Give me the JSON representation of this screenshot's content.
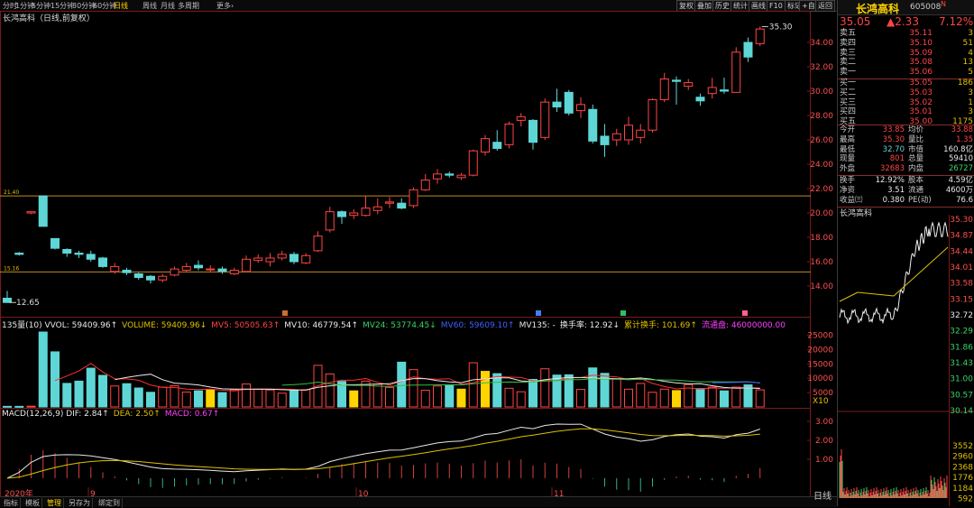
{
  "toolbar": {
    "periods": [
      "分时",
      "1分钟",
      "5分钟",
      "15分钟",
      "30分钟",
      "60分钟",
      "日线",
      "周线",
      "月线",
      "多周期",
      "更多›"
    ],
    "active_period": "日线",
    "right_buttons": [
      "复权",
      "叠加",
      "历史",
      "统计",
      "画线",
      "F10",
      "标记",
      "+自选",
      "返回"
    ]
  },
  "chart_title": "长鸿高科（日线,前复权）",
  "price_axis": [
    "34.00",
    "32.00",
    "30.00",
    "28.00",
    "26.00",
    "24.00",
    "22.00",
    "20.00",
    "18.00",
    "16.00",
    "14.00"
  ],
  "high_label": "35.30",
  "low_label": "12.65",
  "hline_labels": [
    "21.40",
    "15.16"
  ],
  "event_markers": [
    "□",
    "□",
    "□",
    "□"
  ],
  "volume": {
    "header": [
      {
        "t": "135量(10) VVOL: 59409.96↑",
        "c": "#e8e8e8"
      },
      {
        "t": "VOLUME: 59409.96↓",
        "c": "#e0c000"
      },
      {
        "t": "MV5: 50505.63↑",
        "c": "#ff4545"
      },
      {
        "t": "MV10: 46779.54↑",
        "c": "#e8e8e8"
      },
      {
        "t": "MV24: 53774.45↓",
        "c": "#3ad36b"
      },
      {
        "t": "MV60: 59609.10↑",
        "c": "#4060ff"
      },
      {
        "t": "MV135: -",
        "c": "#e8e8e8"
      },
      {
        "t": "换手率: 12.92↓",
        "c": "#e8e8e8"
      },
      {
        "t": "累计换手: 101.69↑",
        "c": "#e0c000"
      },
      {
        "t": "流通盘: 46000000.00",
        "c": "#ff40ff"
      }
    ],
    "axis": [
      "25000",
      "20000",
      "15000",
      "10000",
      "5000"
    ],
    "unit": "X10"
  },
  "macd": {
    "header": [
      {
        "t": "MACD(12,26,9) DIF: 2.84↑",
        "c": "#e8e8e8"
      },
      {
        "t": "DEA: 2.50↑",
        "c": "#e0c000"
      },
      {
        "t": "MACD: 0.67↑",
        "c": "#ff40ff"
      }
    ],
    "axis": [
      "3.00",
      "2.00",
      "1.00"
    ]
  },
  "dates": {
    "year": "2020年",
    "months": [
      "9",
      "10",
      "11"
    ]
  },
  "bottom_tabs": [
    "指标",
    "模板",
    "管理",
    "另存为",
    "绑定到"
  ],
  "active_bottom_tab": "管理",
  "period_label": "日线",
  "right": {
    "name": "长鸿高科",
    "code": "605008",
    "flag": "N",
    "price": "35.05",
    "change": "▲2.33",
    "pct": "7.12%",
    "sells": [
      {
        "l": "卖五",
        "p": "35.11",
        "v": "3"
      },
      {
        "l": "卖四",
        "p": "35.10",
        "v": "51"
      },
      {
        "l": "卖三",
        "p": "35.09",
        "v": "4"
      },
      {
        "l": "卖二",
        "p": "35.08",
        "v": "13"
      },
      {
        "l": "卖一",
        "p": "35.06",
        "v": "5"
      }
    ],
    "buys": [
      {
        "l": "买一",
        "p": "35.05",
        "v": "186"
      },
      {
        "l": "买二",
        "p": "35.03",
        "v": "3"
      },
      {
        "l": "买三",
        "p": "35.02",
        "v": "1"
      },
      {
        "l": "买四",
        "p": "35.01",
        "v": "3"
      },
      {
        "l": "买五",
        "p": "35.00",
        "v": "1175"
      }
    ],
    "stats1": [
      {
        "l": "今开",
        "v": "33.85",
        "vc": "red",
        "l2": "均价",
        "v2": "33.88",
        "v2c": "red"
      },
      {
        "l": "最高",
        "v": "35.30",
        "vc": "red",
        "l2": "量比",
        "v2": "1.35",
        "v2c": "red"
      },
      {
        "l": "最低",
        "v": "32.70",
        "vc": "cyan",
        "l2": "市值",
        "v2": "160.8亿",
        "v2c": "white"
      },
      {
        "l": "现量",
        "v": "801",
        "vc": "red",
        "l2": "总量",
        "v2": "59410",
        "v2c": "white"
      },
      {
        "l": "外盘",
        "v": "32683",
        "vc": "red",
        "l2": "内盘",
        "v2": "26727",
        "v2c": "green"
      }
    ],
    "stats2": [
      {
        "l": "换手",
        "v": "12.92%",
        "vc": "white",
        "l2": "股本",
        "v2": "4.59亿",
        "v2c": "white"
      },
      {
        "l": "净资",
        "v": "3.51",
        "vc": "white",
        "l2": "流通",
        "v2": "4600万",
        "v2c": "white"
      },
      {
        "l": "收益㈢",
        "v": "0.380",
        "vc": "white",
        "l2": "PE(动)",
        "v2": "76.6",
        "v2c": "white"
      }
    ],
    "mini_title": "长鸿高科",
    "mini_axis": [
      "35.30",
      "34.87",
      "34.44",
      "34.01",
      "33.58",
      "33.15",
      "32.72",
      "32.29",
      "31.86",
      "31.43",
      "31.00",
      "30.57",
      "30.14"
    ],
    "mini_vol_axis": [
      "3552",
      "2960",
      "2368",
      "1776",
      "1184",
      "592"
    ],
    "colors": {
      "up": "#ff4545",
      "down": "#5fd6d6",
      "accent": "#ffd400"
    }
  },
  "chart_data": {
    "type": "candlestick",
    "title": "长鸿高科（日线,前复权）",
    "ylim": [
      12,
      36
    ],
    "candles": [
      [
        13.0,
        12.65,
        13.6,
        12.65
      ],
      [
        16.7,
        16.6,
        16.8,
        16.5
      ],
      [
        20.0,
        20.1,
        20.1,
        19.9
      ],
      [
        21.4,
        18.9,
        21.4,
        18.9
      ],
      [
        17.9,
        17.1,
        17.9,
        17.0
      ],
      [
        17.0,
        16.7,
        17.1,
        16.4
      ],
      [
        16.7,
        16.6,
        16.9,
        16.3
      ],
      [
        16.6,
        16.2,
        16.9,
        16.0
      ],
      [
        16.3,
        15.6,
        16.4,
        15.5
      ],
      [
        15.2,
        15.6,
        15.9,
        15.0
      ],
      [
        15.3,
        15.1,
        15.5,
        14.9
      ],
      [
        15.0,
        14.7,
        15.1,
        14.5
      ],
      [
        14.8,
        14.5,
        14.9,
        14.2
      ],
      [
        14.5,
        14.8,
        15.0,
        14.3
      ],
      [
        14.9,
        15.4,
        15.6,
        14.8
      ],
      [
        15.3,
        15.6,
        15.9,
        15.2
      ],
      [
        15.7,
        15.5,
        16.1,
        15.3
      ],
      [
        15.4,
        15.4,
        15.7,
        15.1
      ],
      [
        15.4,
        15.2,
        15.6,
        15.0
      ],
      [
        15.0,
        15.3,
        15.5,
        14.9
      ],
      [
        15.2,
        16.2,
        16.5,
        15.2
      ],
      [
        16.1,
        16.3,
        16.6,
        15.9
      ],
      [
        16.0,
        16.3,
        16.7,
        15.6
      ],
      [
        16.3,
        16.6,
        16.9,
        16.1
      ],
      [
        16.6,
        16.0,
        16.8,
        15.8
      ],
      [
        15.9,
        16.5,
        16.7,
        15.8
      ],
      [
        16.9,
        18.1,
        18.5,
        16.8
      ],
      [
        18.6,
        20.1,
        20.5,
        18.4
      ],
      [
        20.1,
        19.7,
        20.2,
        19.1
      ],
      [
        19.8,
        20.0,
        20.3,
        19.5
      ],
      [
        19.8,
        20.4,
        21.4,
        19.7
      ],
      [
        20.2,
        20.5,
        21.2,
        19.9
      ],
      [
        20.8,
        20.9,
        21.3,
        20.4
      ],
      [
        20.8,
        20.4,
        21.2,
        20.3
      ],
      [
        20.6,
        21.9,
        22.1,
        20.4
      ],
      [
        21.9,
        22.7,
        23.2,
        21.8
      ],
      [
        22.8,
        23.2,
        23.6,
        22.4
      ],
      [
        23.2,
        23.1,
        23.4,
        22.9
      ],
      [
        22.9,
        23.1,
        23.3,
        22.7
      ],
      [
        23.1,
        25.1,
        25.2,
        23.0
      ],
      [
        25.0,
        26.1,
        26.4,
        24.7
      ],
      [
        25.8,
        25.3,
        26.8,
        25.1
      ],
      [
        25.6,
        27.3,
        27.5,
        25.3
      ],
      [
        27.6,
        27.9,
        28.2,
        27.1
      ],
      [
        27.6,
        25.8,
        27.7,
        25.2
      ],
      [
        26.2,
        29.1,
        29.4,
        26.0
      ],
      [
        29.1,
        28.7,
        30.2,
        28.3
      ],
      [
        29.9,
        28.2,
        30.1,
        28.0
      ],
      [
        28.4,
        28.9,
        29.5,
        27.8
      ],
      [
        28.5,
        25.9,
        28.9,
        25.7
      ],
      [
        26.3,
        25.6,
        27.3,
        24.6
      ],
      [
        26.0,
        26.5,
        26.9,
        25.5
      ],
      [
        26.0,
        27.2,
        27.9,
        25.6
      ],
      [
        26.2,
        26.8,
        27.3,
        25.7
      ],
      [
        26.8,
        29.3,
        29.4,
        26.6
      ],
      [
        29.3,
        31.0,
        31.5,
        29.1
      ],
      [
        30.9,
        30.8,
        31.2,
        28.9
      ],
      [
        30.4,
        30.7,
        31.0,
        30.1
      ],
      [
        29.5,
        29.2,
        29.8,
        28.8
      ],
      [
        29.8,
        30.3,
        31.1,
        29.4
      ],
      [
        30.1,
        30.0,
        31.1,
        29.8
      ],
      [
        29.9,
        33.2,
        33.6,
        29.9
      ],
      [
        34.0,
        32.8,
        34.4,
        32.4
      ],
      [
        33.9,
        35.1,
        35.3,
        33.7
      ]
    ],
    "volume": [
      210,
      200,
      260,
      26100,
      19200,
      8200,
      9000,
      13500,
      11000,
      7300,
      8100,
      6600,
      5100,
      6900,
      7400,
      5200,
      5600,
      6100,
      5000,
      6000,
      8000,
      6200,
      5900,
      4800,
      5800,
      6000,
      14500,
      11500,
      8900,
      5600,
      9000,
      7900,
      6800,
      15600,
      13000,
      5800,
      7300,
      7500,
      6200,
      15400,
      12400,
      11600,
      6500,
      5300,
      9600,
      13300,
      11100,
      11200,
      6100,
      13600,
      11700,
      9800,
      6200,
      8200,
      5100,
      6200,
      5700,
      7800,
      6400,
      6900,
      5600,
      6900,
      7700,
      5941
    ],
    "h_lines": [
      21.4,
      15.16
    ]
  }
}
